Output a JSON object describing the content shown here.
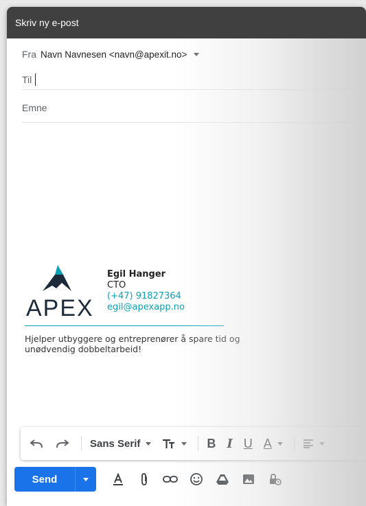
{
  "window": {
    "title": "Skriv ny e-post"
  },
  "compose": {
    "from_label": "Fra",
    "from_value": "Navn Navnesen <navn@apexit.no>",
    "to_label": "Til",
    "subject_placeholder": "Emne"
  },
  "signature": {
    "logo_text": "APEX",
    "name": "Egil Hanger",
    "role": "CTO",
    "phone": "(+47) 91827364",
    "email": "egil@apexapp.no",
    "tagline": "Hjelper utbyggere og entreprenører å spare tid og unødvendig dobbeltarbeid!",
    "accent_color": "#0aa1b4"
  },
  "toolbar": {
    "undo_icon": "undo-icon",
    "redo_icon": "redo-icon",
    "font_family": "Sans Serif",
    "font_size_icon": "text-size-icon",
    "bold_label": "B",
    "italic_label": "I",
    "underline_label": "U",
    "text_color_label": "A",
    "align_icon": "align-icon"
  },
  "actions": {
    "send_label": "Send",
    "send_color": "#1a73e8",
    "icons": [
      "formatting-icon",
      "attach-icon",
      "link-icon",
      "emoji-icon",
      "drive-icon",
      "photo-icon",
      "confidential-icon"
    ]
  }
}
